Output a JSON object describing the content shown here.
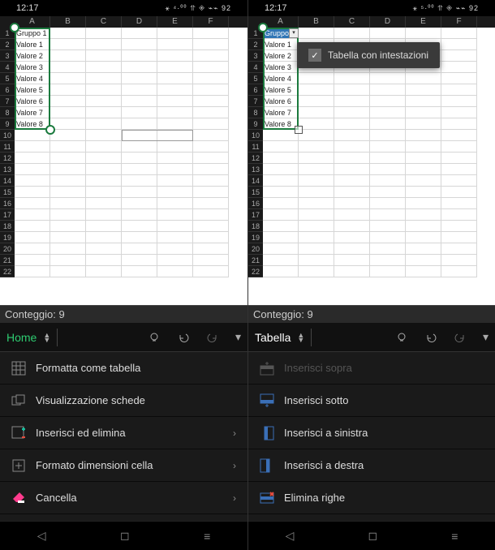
{
  "statusbar": {
    "time": "12:17",
    "icons_left": "⚹ ⁴·⁰⁰ ⥣ ◈ ⌁⌁ 92",
    "icons_right": "⚹ ⁵·⁰⁰ ⥣ ◈ ⌁⌁ 92"
  },
  "columns": [
    "A",
    "B",
    "C",
    "D",
    "E",
    "F"
  ],
  "rows22": [
    "1",
    "2",
    "3",
    "4",
    "5",
    "6",
    "7",
    "8",
    "9",
    "10",
    "11",
    "12",
    "13",
    "14",
    "15",
    "16",
    "17",
    "18",
    "19",
    "20",
    "21",
    "22"
  ],
  "dataA": [
    "Gruppo 1",
    "Valore 1",
    "Valore 2",
    "Valore 3",
    "Valore 4",
    "Valore 5",
    "Valore 6",
    "Valore 7",
    "Valore 8"
  ],
  "countbar": {
    "label": "Conteggio: 9"
  },
  "tooltip": {
    "text": "Tabella con intestazioni"
  },
  "ribbon": {
    "left": {
      "name": "Home"
    },
    "right": {
      "name": "Tabella"
    }
  },
  "menu_left": [
    {
      "key": "formatta",
      "label": "Formatta come tabella",
      "chevron": false
    },
    {
      "key": "visualizza",
      "label": "Visualizzazione schede",
      "chevron": false
    },
    {
      "key": "inserisci-elimina",
      "label": "Inserisci ed elimina",
      "chevron": true
    },
    {
      "key": "dimensioni",
      "label": "Formato dimensioni cella",
      "chevron": true
    },
    {
      "key": "cancella",
      "label": "Cancella",
      "chevron": true
    }
  ],
  "menu_right": [
    {
      "key": "ins-sopra",
      "label": "Inserisci sopra",
      "disabled": true
    },
    {
      "key": "ins-sotto",
      "label": "Inserisci sotto"
    },
    {
      "key": "ins-sinistra",
      "label": "Inserisci a sinistra"
    },
    {
      "key": "ins-destra",
      "label": "Inserisci a destra"
    },
    {
      "key": "elimina-righe",
      "label": "Elimina righe"
    }
  ]
}
